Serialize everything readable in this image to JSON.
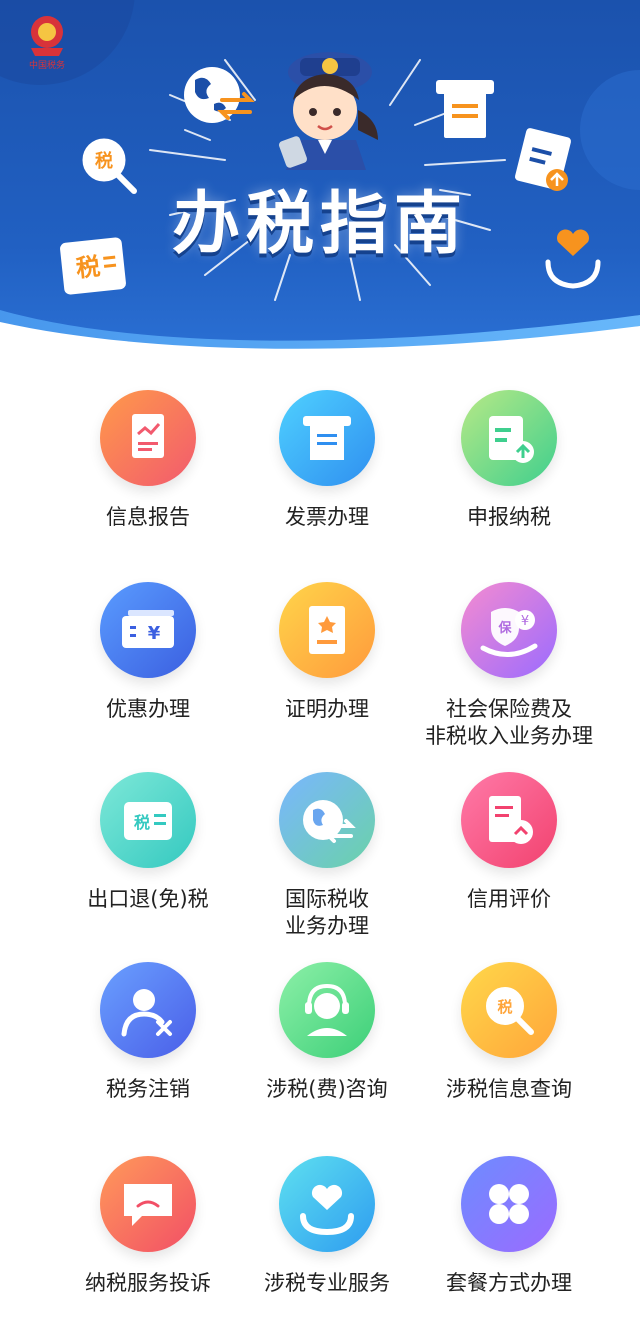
{
  "header": {
    "emblem_caption": "中国税务",
    "title": "办税指南",
    "seal_label": "税",
    "card_label": "税"
  },
  "menu": [
    {
      "label": "信息报告",
      "icon": "report-chart-icon",
      "colors": [
        "#ff9a4a",
        "#f25a6e"
      ]
    },
    {
      "label": "发票办理",
      "icon": "invoice-icon",
      "colors": [
        "#4fd1ff",
        "#2f8ff0"
      ]
    },
    {
      "label": "申报纳税",
      "icon": "tax-declaration-icon",
      "colors": [
        "#b8e986",
        "#3fcf8e"
      ]
    },
    {
      "label": "优惠办理",
      "icon": "yuan-ticket-icon",
      "colors": [
        "#5a9cff",
        "#3b5fe0"
      ]
    },
    {
      "label": "证明办理",
      "icon": "certificate-icon",
      "colors": [
        "#ffd54a",
        "#ff9a3c"
      ]
    },
    {
      "label": "社会保险费及\n非税收入业务办理",
      "icon": "insurance-hand-icon",
      "colors": [
        "#f58bd0",
        "#9b6bff"
      ]
    },
    {
      "label": "出口退(免)税",
      "icon": "tax-card-icon",
      "colors": [
        "#7ee8d8",
        "#34c9c0"
      ]
    },
    {
      "label": "国际税收\n业务办理",
      "icon": "globe-exchange-icon",
      "colors": [
        "#7ab6ff",
        "#6ad2a8"
      ]
    },
    {
      "label": "信用评价",
      "icon": "credit-gauge-icon",
      "colors": [
        "#ff7aa8",
        "#f2426f"
      ]
    },
    {
      "label": "税务注销",
      "icon": "user-remove-icon",
      "colors": [
        "#6aa0ff",
        "#4a5ee8"
      ]
    },
    {
      "label": "涉税(费)咨询",
      "icon": "headset-icon",
      "colors": [
        "#8df0a8",
        "#3ccf78"
      ]
    },
    {
      "label": "涉税信息查询",
      "icon": "tax-search-icon",
      "colors": [
        "#ffd84a",
        "#ffa53a"
      ]
    },
    {
      "label": "纳税服务投诉",
      "icon": "complaint-chat-icon",
      "colors": [
        "#ff9a5a",
        "#f24f66"
      ]
    },
    {
      "label": "涉税专业服务",
      "icon": "heart-hands-icon",
      "colors": [
        "#5ee0f0",
        "#2e9cf0"
      ]
    },
    {
      "label": "套餐方式办理",
      "icon": "package-grid-icon",
      "colors": [
        "#6d8cff",
        "#9b6bff"
      ]
    }
  ]
}
